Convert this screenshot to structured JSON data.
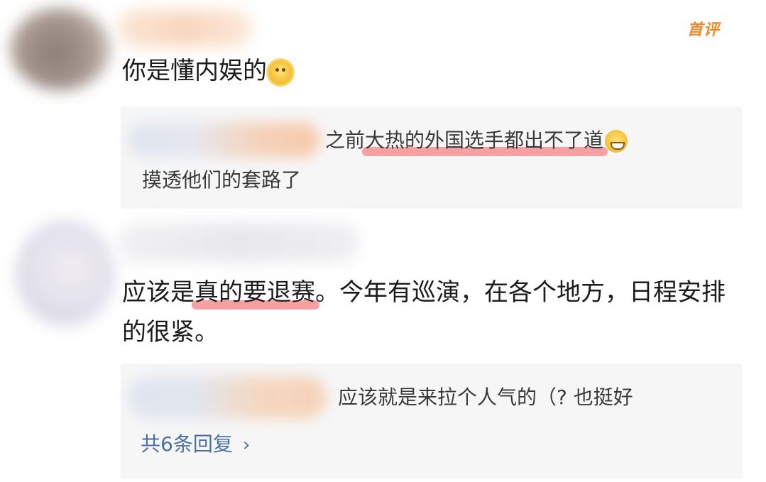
{
  "comments": [
    {
      "badge": "首评",
      "text": "你是懂内娱的",
      "reply": {
        "text_part1": "之前",
        "text_highlight": "大热的外国选手都出不了道",
        "text_line2": "摸透他们的套路了"
      }
    },
    {
      "text_part1": "应该是",
      "text_highlight": "真的要退赛",
      "text_part2": "。今年有巡演，在各个地方，日程安排的很紧。",
      "reply": {
        "text": "应该就是来拉个人气的（? 也挺好",
        "more_replies": "共6条回复"
      }
    }
  ],
  "icons": {
    "first_comment_emoji": "smile-emoji-icon",
    "reply_emoji": "grin-emoji-icon",
    "more_chevron": "chevron-right-icon"
  },
  "colors": {
    "badge": "#f08a28",
    "link": "#4a6fa5",
    "highlight": "#f6a0a4",
    "reply_bg": "#f6f6f7"
  }
}
